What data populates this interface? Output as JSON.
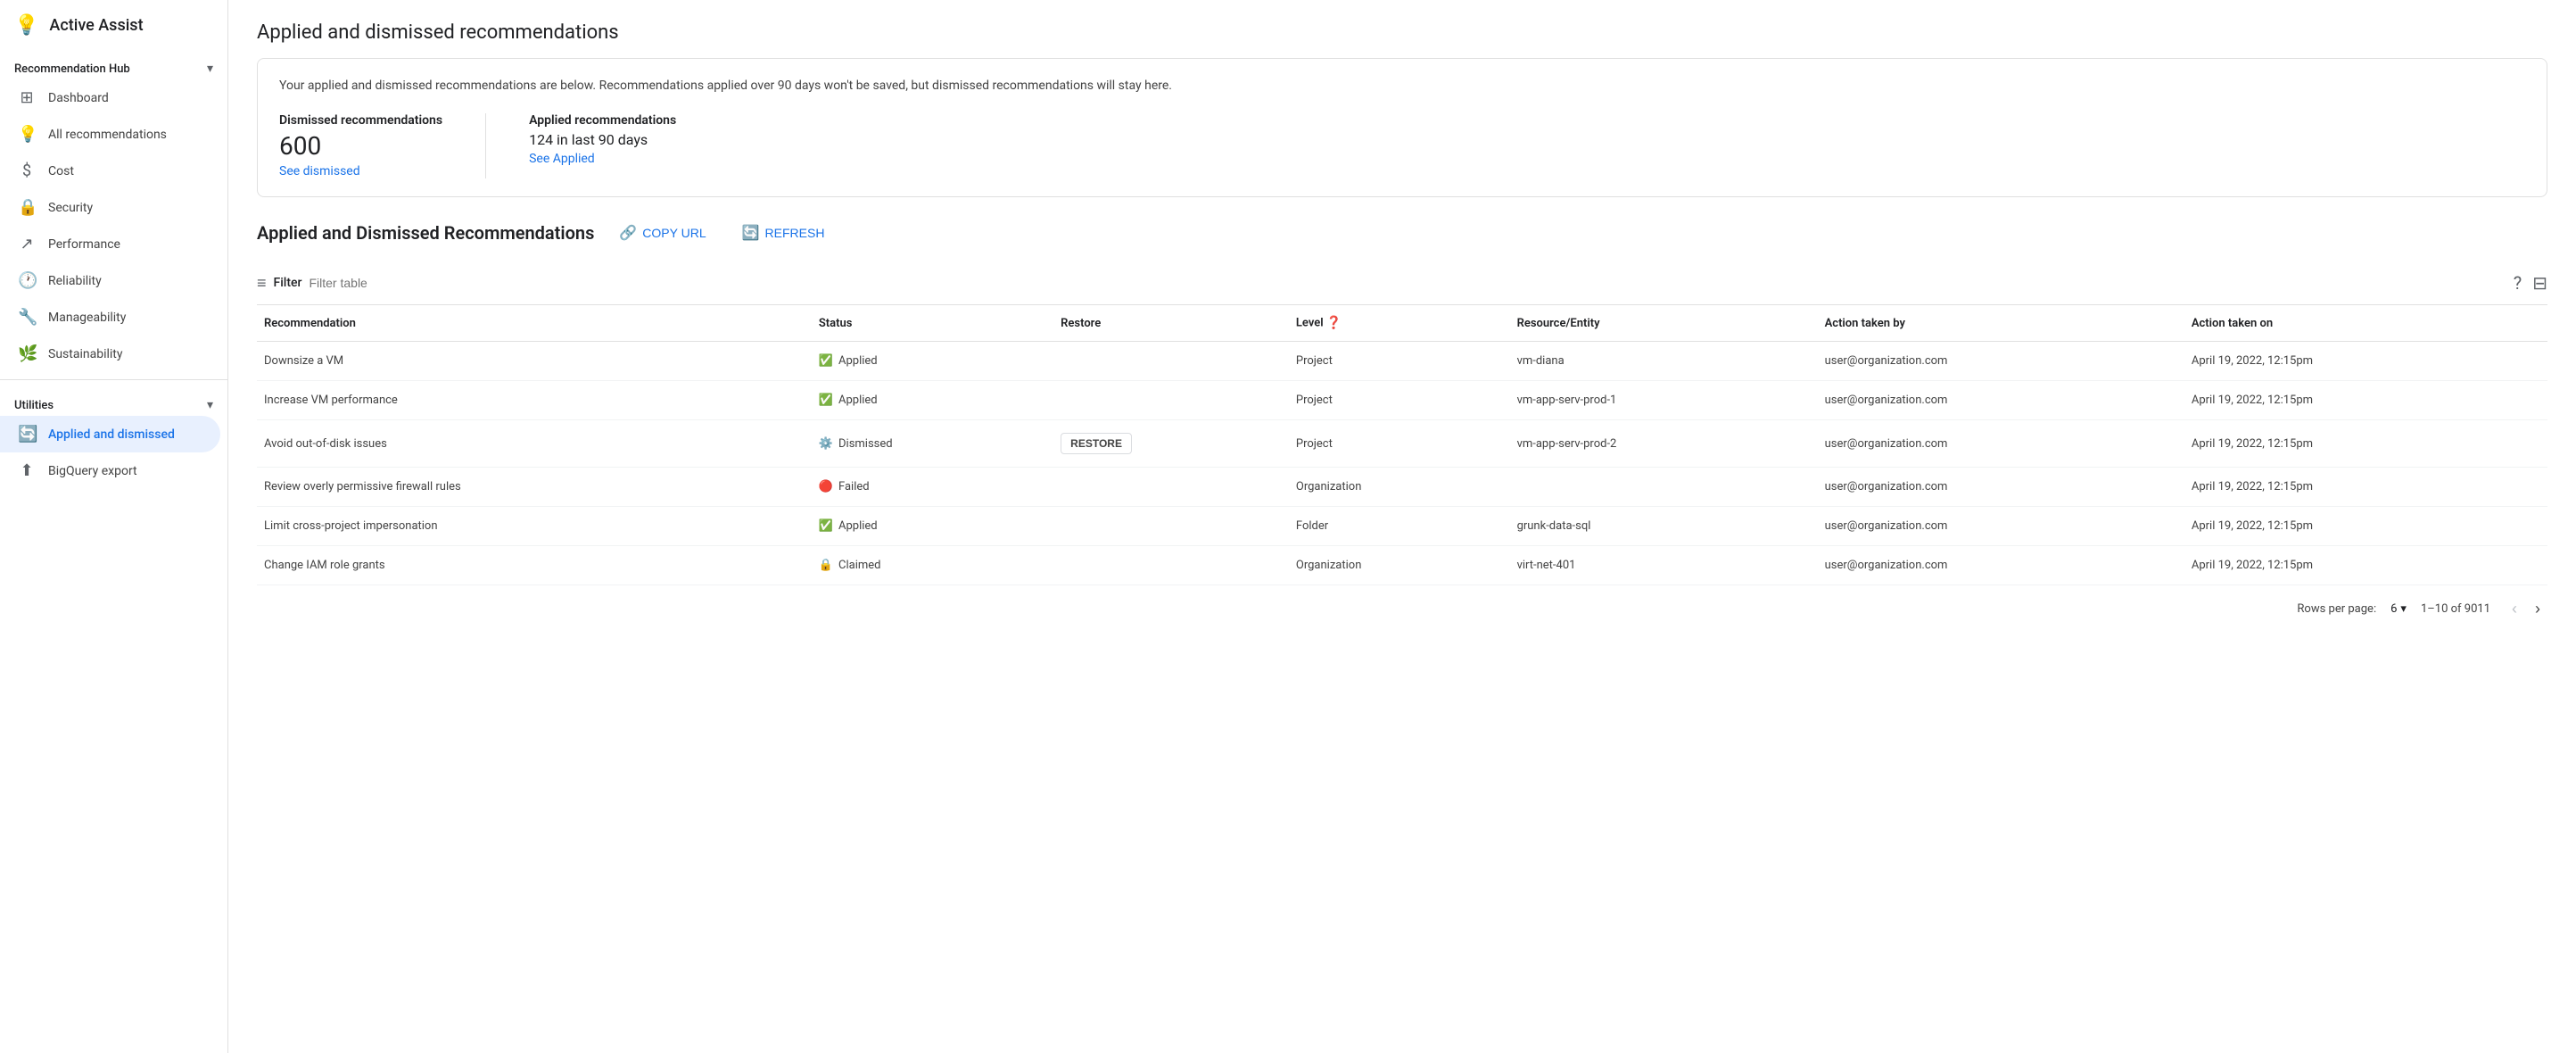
{
  "sidebar": {
    "app_title": "Active Assist",
    "app_icon": "💡",
    "recommendation_hub": {
      "label": "Recommendation Hub",
      "items": [
        {
          "id": "dashboard",
          "label": "Dashboard",
          "icon": "⊞"
        },
        {
          "id": "all-recommendations",
          "label": "All recommendations",
          "icon": "💡"
        },
        {
          "id": "cost",
          "label": "Cost",
          "icon": "$"
        },
        {
          "id": "security",
          "label": "Security",
          "icon": "🔒"
        },
        {
          "id": "performance",
          "label": "Performance",
          "icon": "↗"
        },
        {
          "id": "reliability",
          "label": "Reliability",
          "icon": "🕐"
        },
        {
          "id": "manageability",
          "label": "Manageability",
          "icon": "🔧"
        },
        {
          "id": "sustainability",
          "label": "Sustainability",
          "icon": "🌿"
        }
      ]
    },
    "utilities": {
      "label": "Utilities",
      "items": [
        {
          "id": "applied-and-dismissed",
          "label": "Applied and dismissed",
          "icon": "🔄",
          "active": true
        },
        {
          "id": "bigquery-export",
          "label": "BigQuery export",
          "icon": "⬆"
        }
      ]
    }
  },
  "main": {
    "title": "Applied and dismissed recommendations",
    "info_box": {
      "description": "Your applied and dismissed recommendations are below. Recommendations applied over 90 days won't be saved, but dismissed recommendations will stay here.",
      "dismissed": {
        "label": "Dismissed recommendations",
        "count": "600",
        "link_text": "See dismissed"
      },
      "applied": {
        "label": "Applied recommendations",
        "value": "124 in last 90 days",
        "link_text": "See Applied"
      }
    },
    "section_title": "Applied and Dismissed Recommendations",
    "copy_url_label": "COPY URL",
    "refresh_label": "REFRESH",
    "filter": {
      "label": "Filter",
      "placeholder": "Filter table"
    },
    "table": {
      "columns": [
        {
          "id": "recommendation",
          "label": "Recommendation"
        },
        {
          "id": "status",
          "label": "Status"
        },
        {
          "id": "restore",
          "label": "Restore"
        },
        {
          "id": "level",
          "label": "Level"
        },
        {
          "id": "resource",
          "label": "Resource/Entity"
        },
        {
          "id": "action_by",
          "label": "Action taken by"
        },
        {
          "id": "action_on",
          "label": "Action taken on"
        }
      ],
      "rows": [
        {
          "recommendation": "Downsize a VM",
          "status": "Applied",
          "status_type": "applied",
          "restore": "",
          "level": "Project",
          "resource": "vm-diana",
          "action_by": "user@organization.com",
          "action_on": "April 19, 2022, 12:15pm"
        },
        {
          "recommendation": "Increase VM performance",
          "status": "Applied",
          "status_type": "applied",
          "restore": "",
          "level": "Project",
          "resource": "vm-app-serv-prod-1",
          "action_by": "user@organization.com",
          "action_on": "April 19, 2022, 12:15pm"
        },
        {
          "recommendation": "Avoid out-of-disk issues",
          "status": "Dismissed",
          "status_type": "dismissed",
          "restore": "RESTORE",
          "level": "Project",
          "resource": "vm-app-serv-prod-2",
          "action_by": "user@organization.com",
          "action_on": "April 19, 2022, 12:15pm"
        },
        {
          "recommendation": "Review overly permissive firewall rules",
          "status": "Failed",
          "status_type": "failed",
          "restore": "",
          "level": "Organization",
          "resource": "",
          "action_by": "user@organization.com",
          "action_on": "April 19, 2022, 12:15pm"
        },
        {
          "recommendation": "Limit cross-project impersonation",
          "status": "Applied",
          "status_type": "applied",
          "restore": "",
          "level": "Folder",
          "resource": "grunk-data-sql",
          "action_by": "user@organization.com",
          "action_on": "April 19, 2022, 12:15pm"
        },
        {
          "recommendation": "Change IAM role grants",
          "status": "Claimed",
          "status_type": "claimed",
          "restore": "",
          "level": "Organization",
          "resource": "virt-net-401",
          "action_by": "user@organization.com",
          "action_on": "April 19, 2022, 12:15pm"
        }
      ]
    },
    "pagination": {
      "rows_per_page_label": "Rows per page:",
      "rows_per_page_value": "6",
      "range": "1–10 of 9011"
    }
  }
}
